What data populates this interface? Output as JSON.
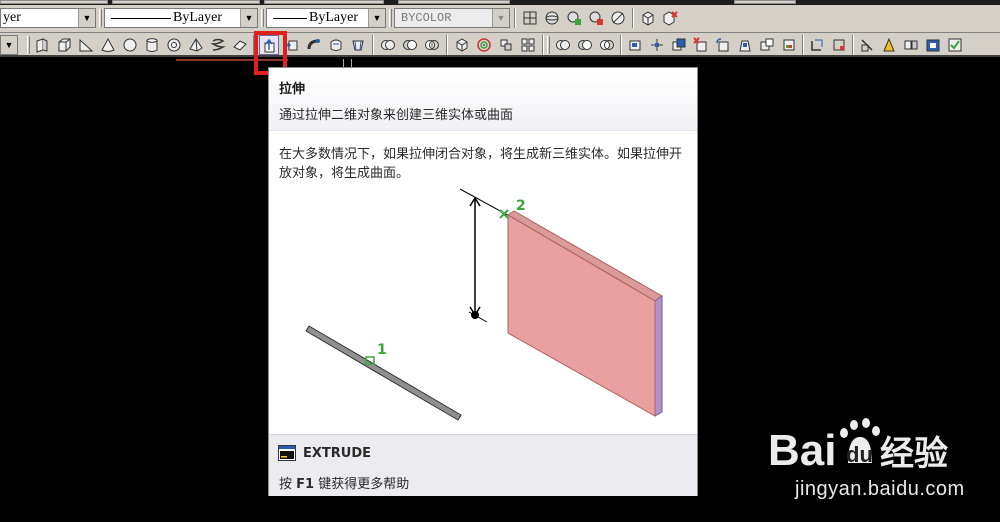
{
  "toolbar_top": {
    "layer_combo": "yer",
    "linetype_combo": "ByLayer",
    "lineweight_combo": "ByLayer",
    "color_combo": "BYCOLOR"
  },
  "toolbar_modeling": {
    "icons": [
      "polysolid-icon",
      "box-icon",
      "wedge-icon",
      "cone-icon",
      "sphere-icon",
      "cylinder-icon",
      "torus-icon",
      "pyramid-icon",
      "helix-icon",
      "planar-surface-icon",
      "extrude-icon",
      "presspull-icon",
      "sweep-icon",
      "revolve-icon",
      "loft-icon"
    ],
    "highlighted": "extrude-icon"
  },
  "tooltip": {
    "title": "拉伸",
    "short_desc": "通过拉伸二维对象来创建三维实体或曲面",
    "long_desc": "在大多数情况下，如果拉伸闭合对象，将生成新三维实体。如果拉伸开放对象，将生成曲面。",
    "illustration_labels": [
      "1",
      "2"
    ],
    "command": "EXTRUDE",
    "help_prefix": "按",
    "help_key": "F1",
    "help_suffix": "键获得更多帮助"
  },
  "colors": {
    "highlight": "#e01f1f",
    "extrude_face": "#e8a0a0",
    "extrude_side": "#b391c9",
    "label_green": "#3aa63a"
  },
  "watermark": {
    "logo_text": "Bai du 经验",
    "url": "jingyan.baidu.com"
  }
}
